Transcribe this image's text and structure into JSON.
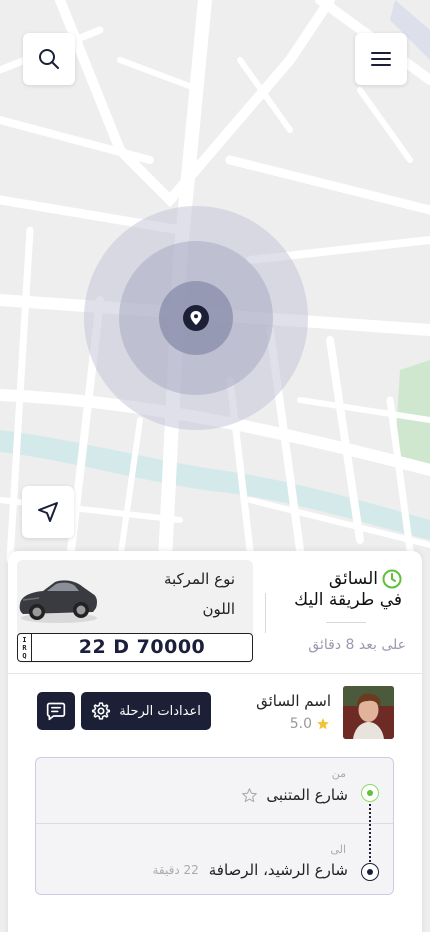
{
  "status": {
    "title": "السائق",
    "subtitle": "في طريقة اليك",
    "eta": "على بعد 8 دقائق"
  },
  "vehicle": {
    "type_label": "نوع المركبة",
    "color_label": "اللون",
    "plate_country": [
      "I",
      "R",
      "Q"
    ],
    "plate_number": "22 D 70000"
  },
  "driver": {
    "name": "اسم السائق",
    "rating": "5.0"
  },
  "actions": {
    "trip_settings_label": "اعدادات الرحلة"
  },
  "route": {
    "from_label": "من",
    "from_street": "شارع المتنبى",
    "to_label": "الى",
    "to_street": "شارع الرشيد، الرصافة",
    "to_time": "22 دقيقة"
  },
  "icons": {
    "search": "search-icon",
    "menu": "menu-icon",
    "navigate": "navigation-arrow-icon",
    "clock": "clock-icon",
    "star": "star-icon",
    "gear": "gear-icon",
    "chat": "chat-icon",
    "location_pin": "location-pin-icon"
  },
  "colors": {
    "primary_dark": "#1b2036",
    "accent_green": "#5fc03a",
    "muted_text": "#9a9ab0",
    "star_gold": "#f2c237"
  }
}
